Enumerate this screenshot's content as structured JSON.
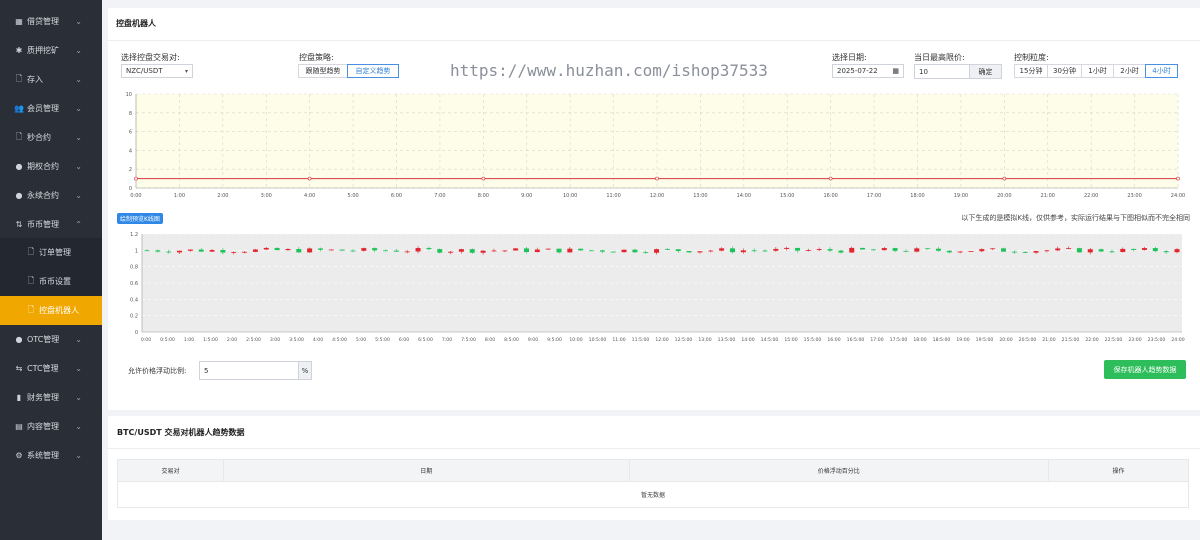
{
  "sidebar": {
    "items": [
      {
        "icon": "▦",
        "label": "借贷管理"
      },
      {
        "icon": "✱",
        "label": "质押挖矿"
      },
      {
        "icon": "🗋",
        "label": "存入"
      },
      {
        "icon": "👥",
        "label": "会员管理"
      },
      {
        "icon": "🗋",
        "label": "秒合约"
      },
      {
        "icon": "●",
        "label": "期权合约"
      },
      {
        "icon": "●",
        "label": "永续合约"
      },
      {
        "icon": "⇅",
        "label": "币币管理"
      },
      {
        "icon": "🗋",
        "label": "订单管理"
      },
      {
        "icon": "🗋",
        "label": "币币设置"
      },
      {
        "icon": "🗋",
        "label": "控盘机器人"
      },
      {
        "icon": "●",
        "label": "OTC管理"
      },
      {
        "icon": "⇆",
        "label": "CTC管理"
      },
      {
        "icon": "▮",
        "label": "财务管理"
      },
      {
        "icon": "▤",
        "label": "内容管理"
      },
      {
        "icon": "⚙",
        "label": "系统管理"
      }
    ]
  },
  "control": {
    "title": "控盘机器人",
    "pair_label": "选择控盘交易对:",
    "pair_value": "NZC/USDT",
    "strategy_label": "控盘策略:",
    "strategies": [
      "跟随型趋势",
      "自定义趋势"
    ],
    "date_label": "选择日期:",
    "date_value": "2025-07-22",
    "high_label": "当日最高限价:",
    "high_value": "10",
    "confirm_label": "确定",
    "granularity_label": "控制粒度:",
    "granularity": [
      "15分钟",
      "30分钟",
      "1小时",
      "2小时",
      "4小时"
    ],
    "watermark": "https://www.huzhan.com/ishop37533",
    "preview_btn": "绘制预览K线图",
    "note": "以下生成的是模拟K线，仅供参考，实际运行结果与下图相似而不完全相同",
    "float_label": "允许价格浮动比例:",
    "float_value": "5",
    "float_unit": "%",
    "save_label": "保存机器人趋势数据"
  },
  "chart_data": [
    {
      "type": "line",
      "title": "",
      "ylim": [
        0,
        10
      ],
      "yticks": [
        "0",
        "2",
        "4",
        "6",
        "8",
        "10"
      ],
      "x": [
        "0:00",
        "1:00",
        "2:00",
        "3:00",
        "4:00",
        "5:00",
        "6:00",
        "7:00",
        "8:00",
        "9:00",
        "10:00",
        "11:00",
        "12:00",
        "13:00",
        "14:00",
        "15:00",
        "16:00",
        "17:00",
        "18:00",
        "19:00",
        "20:00",
        "21:00",
        "22:00",
        "23:00",
        "24:00"
      ],
      "series": [
        {
          "values": [
            1,
            1,
            1,
            1,
            1,
            1,
            1,
            1,
            1,
            1,
            1,
            1,
            1,
            1,
            1,
            1,
            1,
            1,
            1,
            1,
            1,
            1,
            1,
            1,
            1
          ]
        }
      ],
      "line_color": "#d9363e",
      "bg_color": "#fdfde9"
    },
    {
      "type": "candlestick",
      "title": "",
      "ylim": [
        0,
        1.2
      ],
      "yticks": [
        "0",
        "0.2",
        "0.4",
        "0.6",
        "0.8",
        "1",
        "1.2"
      ],
      "x": [
        "0:00",
        "0:5:00",
        "1:00",
        "1:5:00",
        "2:00",
        "2:5:00",
        "3:00",
        "3:5:00",
        "4:00",
        "4:5:00",
        "5:00",
        "5:5:00",
        "6:00",
        "6:5:00",
        "7:00",
        "7:5:00",
        "8:00",
        "8:5:00",
        "9:00",
        "9:5:00",
        "10:00",
        "10:5:00",
        "11:00",
        "11:5:00",
        "12:00",
        "12:5:00",
        "13:00",
        "13:5:00",
        "14:00",
        "14:5:00",
        "15:00",
        "15:5:00",
        "16:00",
        "16:5:00",
        "17:00",
        "17:5:00",
        "18:00",
        "18:5:00",
        "19:00",
        "19:5:00",
        "20:00",
        "20:5:00",
        "21:00",
        "21:5:00",
        "22:00",
        "22:5:00",
        "23:00",
        "23:5:00",
        "24:00"
      ],
      "up_color": "#e0262e",
      "down_color": "#1fc25a"
    }
  ],
  "table": {
    "title": "BTC/USDT 交易对机器人趋势数据",
    "columns": [
      "交易对",
      "日期",
      "价格浮动百分比",
      "操作"
    ],
    "empty": "暂无数据"
  }
}
